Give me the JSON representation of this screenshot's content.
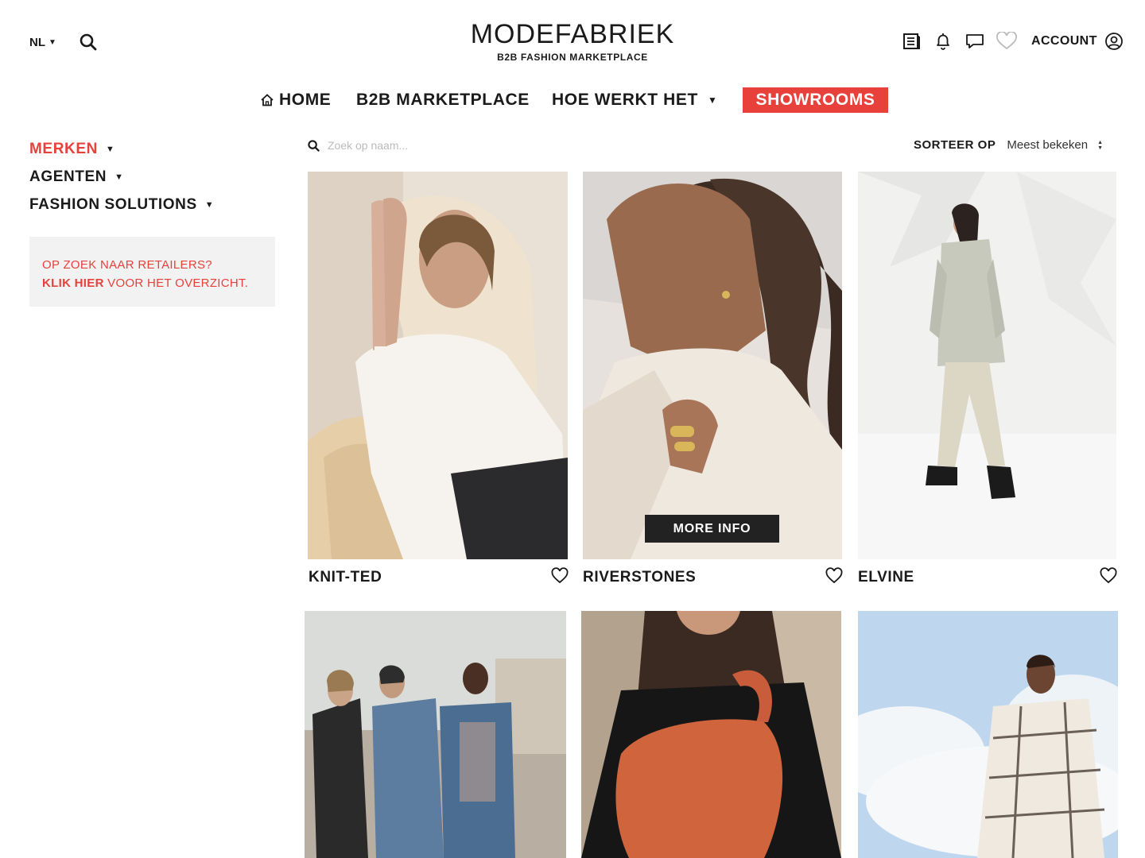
{
  "header": {
    "language": "NL",
    "logo_title": "MODEFABRIEK",
    "logo_subtitle": "B2B FASHION MARKETPLACE",
    "account_label": "ACCOUNT",
    "icons": [
      "catalog-icon",
      "bell-icon",
      "chat-icon",
      "heart-icon",
      "user-icon"
    ]
  },
  "nav": {
    "home": "HOME",
    "b2b": "B2B MARKETPLACE",
    "hoe": "HOE WERKT HET",
    "showrooms": "SHOWROOMS"
  },
  "sidebar": {
    "items": [
      {
        "label": "MERKEN"
      },
      {
        "label": "AGENTEN"
      },
      {
        "label": "FASHION SOLUTIONS"
      }
    ],
    "promo": {
      "line1": "OP ZOEK NAAR RETAILERS?",
      "link": "KLIK HIER",
      "line2_rest": " VOOR HET OVERZICHT."
    }
  },
  "search": {
    "placeholder": "Zoek op naam..."
  },
  "sort": {
    "label": "SORTEER OP",
    "value": "Meest bekeken"
  },
  "cards": [
    {
      "name": "KNIT-TED"
    },
    {
      "name": "RIVERSTONES",
      "more_info": "MORE INFO"
    },
    {
      "name": "ELVINE"
    },
    {
      "name": ""
    },
    {
      "name": ""
    },
    {
      "name": ""
    }
  ],
  "colors": {
    "accent": "#e8403a",
    "text": "#1a1a1a",
    "promo_bg": "#f2f2f2",
    "overlay_button": "#222222"
  }
}
